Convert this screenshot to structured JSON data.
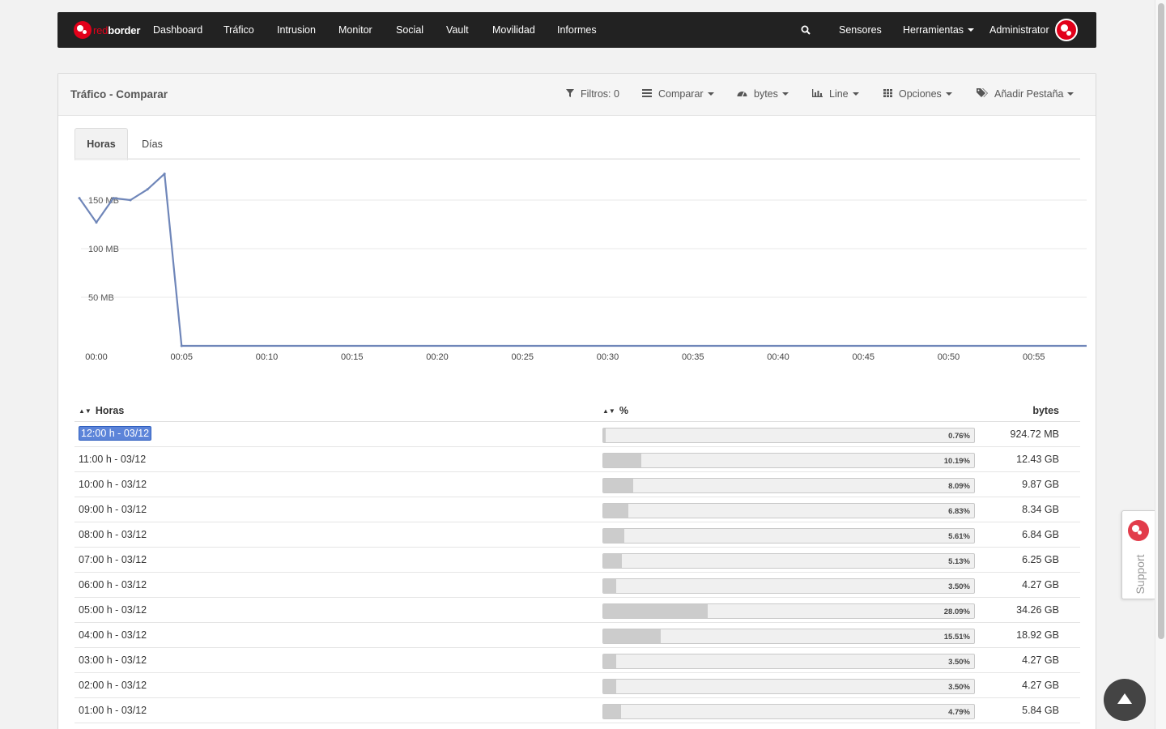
{
  "brand": {
    "red": "red",
    "white": "border"
  },
  "nav": {
    "items": [
      "Dashboard",
      "Tráfico",
      "Intrusion",
      "Monitor",
      "Social",
      "Vault",
      "Movilidad",
      "Informes"
    ],
    "search_icon": "search-icon",
    "sensores": "Sensores",
    "herramientas": "Herramientas",
    "admin": "Administrator"
  },
  "panel": {
    "title": "Tráfico - Comparar",
    "tools": {
      "filtros": "Filtros: 0",
      "comparar": "Comparar",
      "bytes": "bytes",
      "line": "Line",
      "opciones": "Opciones",
      "anadir": "Añadir Pestaña"
    },
    "tabs": [
      "Horas",
      "Días"
    ]
  },
  "chart_data": {
    "type": "line",
    "x_ticks": [
      "00:00",
      "00:05",
      "00:10",
      "00:15",
      "00:20",
      "00:25",
      "00:30",
      "00:35",
      "00:40",
      "00:45",
      "00:50",
      "00:55"
    ],
    "y_ticks": [
      "50 MB",
      "100 MB",
      "150 MB"
    ],
    "series": [
      {
        "x": [
          "23:59",
          "00:00",
          "00:01",
          "00:02",
          "00:03",
          "00:04",
          "00:05",
          "00:06",
          "01:00"
        ],
        "values_mb": [
          152,
          127,
          152,
          150,
          161,
          177,
          0,
          0,
          0
        ]
      }
    ],
    "ylim": [
      0,
      180
    ],
    "color": "#6f86b9",
    "grid": true
  },
  "table": {
    "headers": {
      "horas": "Horas",
      "pct": "%",
      "bytes": "bytes"
    },
    "rows": [
      {
        "hour": "12:00 h - 03/12",
        "pct": "0.76%",
        "frac": 0.0076,
        "bytes": "924.72 MB",
        "selected": true
      },
      {
        "hour": "11:00 h - 03/12",
        "pct": "10.19%",
        "frac": 0.1019,
        "bytes": "12.43 GB"
      },
      {
        "hour": "10:00 h - 03/12",
        "pct": "8.09%",
        "frac": 0.0809,
        "bytes": "9.87 GB"
      },
      {
        "hour": "09:00 h - 03/12",
        "pct": "6.83%",
        "frac": 0.0683,
        "bytes": "8.34 GB"
      },
      {
        "hour": "08:00 h - 03/12",
        "pct": "5.61%",
        "frac": 0.0561,
        "bytes": "6.84 GB"
      },
      {
        "hour": "07:00 h - 03/12",
        "pct": "5.13%",
        "frac": 0.0513,
        "bytes": "6.25 GB"
      },
      {
        "hour": "06:00 h - 03/12",
        "pct": "3.50%",
        "frac": 0.035,
        "bytes": "4.27 GB"
      },
      {
        "hour": "05:00 h - 03/12",
        "pct": "28.09%",
        "frac": 0.2809,
        "bytes": "34.26 GB"
      },
      {
        "hour": "04:00 h - 03/12",
        "pct": "15.51%",
        "frac": 0.1551,
        "bytes": "18.92 GB"
      },
      {
        "hour": "03:00 h - 03/12",
        "pct": "3.50%",
        "frac": 0.035,
        "bytes": "4.27 GB"
      },
      {
        "hour": "02:00 h - 03/12",
        "pct": "3.50%",
        "frac": 0.035,
        "bytes": "4.27 GB"
      },
      {
        "hour": "01:00 h - 03/12",
        "pct": "4.79%",
        "frac": 0.0479,
        "bytes": "5.84 GB"
      }
    ]
  },
  "support": {
    "label": "Support"
  }
}
